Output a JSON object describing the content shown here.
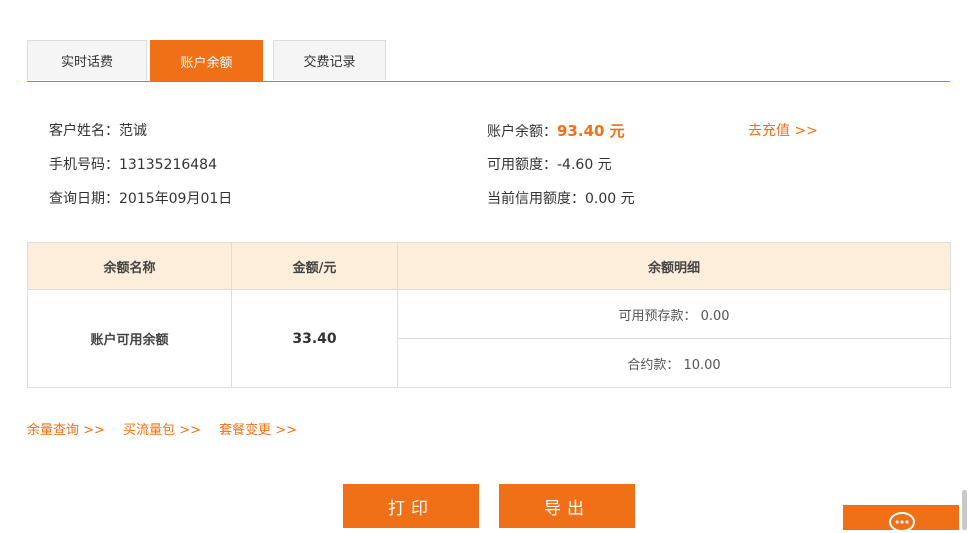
{
  "tabs": [
    {
      "label": "实时话费"
    },
    {
      "label": "账户余额"
    },
    {
      "label": "交费记录"
    }
  ],
  "customer": {
    "name_label": "客户姓名：",
    "name_value": "范诚",
    "phone_label": "手机号码：",
    "phone_value": "13135216484",
    "date_label": "查询日期：",
    "date_value": "2015年09月01日"
  },
  "account": {
    "balance_label": "账户余额：",
    "balance_value": "93.40 元",
    "available_label": "可用额度：",
    "available_value": "-4.60 元",
    "credit_label": "当前信用额度：",
    "credit_value": "0.00 元",
    "recharge_link": "去充值 >>"
  },
  "table": {
    "headers": [
      "余额名称",
      "金额/元",
      "余额明细"
    ],
    "row_name": "账户可用余额",
    "row_amount": "33.40",
    "details": [
      "可用预存款： 0.00",
      "合约款： 10.00"
    ]
  },
  "links": [
    "余量查询 >>",
    "买流量包 >>",
    "套餐变更 >>"
  ],
  "buttons": {
    "print": "打印",
    "export": "导出"
  },
  "colors": {
    "accent": "#f07018",
    "header_bg": "#fdeedb"
  }
}
